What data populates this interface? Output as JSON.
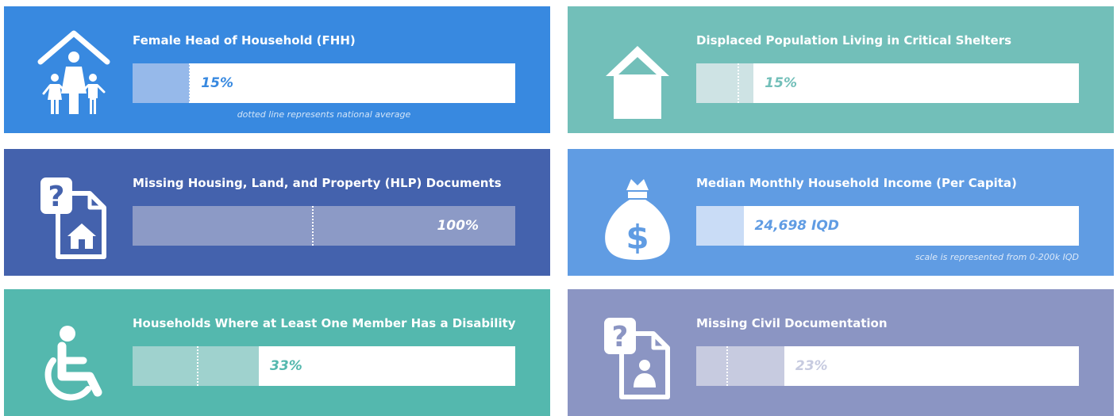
{
  "colors": {
    "blue": "#3889e0",
    "teal": "#72bfb9",
    "navy": "#4462ad",
    "sky": "#609ce3",
    "green": "#54b8ae",
    "lavender": "#8b95c3",
    "track": "#ffffff"
  },
  "scale_note": "scale is represented from 0-200k IQD",
  "national_average_note": "dotted line represents national average",
  "cards": [
    {
      "id": "fhh",
      "title": "Female Head of Household (FHH)",
      "value": 15,
      "value_label": "15%",
      "national_average": 15,
      "scale_max": 100,
      "bg": "#3889e0",
      "fill": "#96b9ea",
      "label_color": "#3889e0",
      "icon": "family-house-icon",
      "note": "dotted line represents national average"
    },
    {
      "id": "critical-shelters",
      "title": "Displaced Population Living in Critical Shelters",
      "value": 15,
      "value_label": "15%",
      "national_average": 11,
      "scale_max": 100,
      "bg": "#72bfb9",
      "fill": "#cee3e4",
      "label_color": "#72bfb9",
      "icon": "house-icon"
    },
    {
      "id": "hlp-documents",
      "title": "Missing Housing, Land, and Property (HLP) Documents",
      "value": 100,
      "value_label": "100%",
      "national_average": 47,
      "scale_max": 100,
      "bg": "#4462ad",
      "fill": "#8c9ac6",
      "label_color": "#ffffff",
      "icon": "missing-house-document-icon"
    },
    {
      "id": "income",
      "title": "Median Monthly Household Income (Per Capita)",
      "value": 24698,
      "value_label": "24,698 IQD",
      "national_average": 37000,
      "scale_max": 200000,
      "bg": "#609ce3",
      "fill": "#c9dcf6",
      "label_color": "#609ce3",
      "icon": "money-bag-icon",
      "note": "scale is represented from 0-200k IQD"
    },
    {
      "id": "disability",
      "title": "Households Where at Least One Member Has a Disability",
      "value": 33,
      "value_label": "33%",
      "national_average": 17,
      "scale_max": 100,
      "bg": "#54b8ae",
      "fill": "#9fd2ce",
      "label_color": "#54b8ae",
      "icon": "wheelchair-icon"
    },
    {
      "id": "civil-documentation",
      "title": "Missing Civil Documentation",
      "value": 23,
      "value_label": "23%",
      "national_average": 8,
      "scale_max": 100,
      "bg": "#8b95c3",
      "fill": "#c7cbe0",
      "label_color": "#c7cbe0",
      "icon": "missing-id-document-icon"
    }
  ],
  "chart_data": {
    "type": "bar",
    "categories": [
      "Female Head of Household (FHH)",
      "Displaced Population Living in Critical Shelters",
      "Missing Housing, Land, and Property (HLP) Documents",
      "Median Monthly Household Income (Per Capita)",
      "Households Where at Least One Member Has a Disability",
      "Missing Civil Documentation"
    ],
    "values": [
      15,
      15,
      100,
      24698,
      33,
      23
    ],
    "units": [
      "%",
      "%",
      "%",
      "IQD",
      "%",
      "%"
    ],
    "national_average": [
      15,
      11,
      47,
      37000,
      17,
      8
    ],
    "scale_max": [
      100,
      100,
      100,
      200000,
      100,
      100
    ]
  }
}
